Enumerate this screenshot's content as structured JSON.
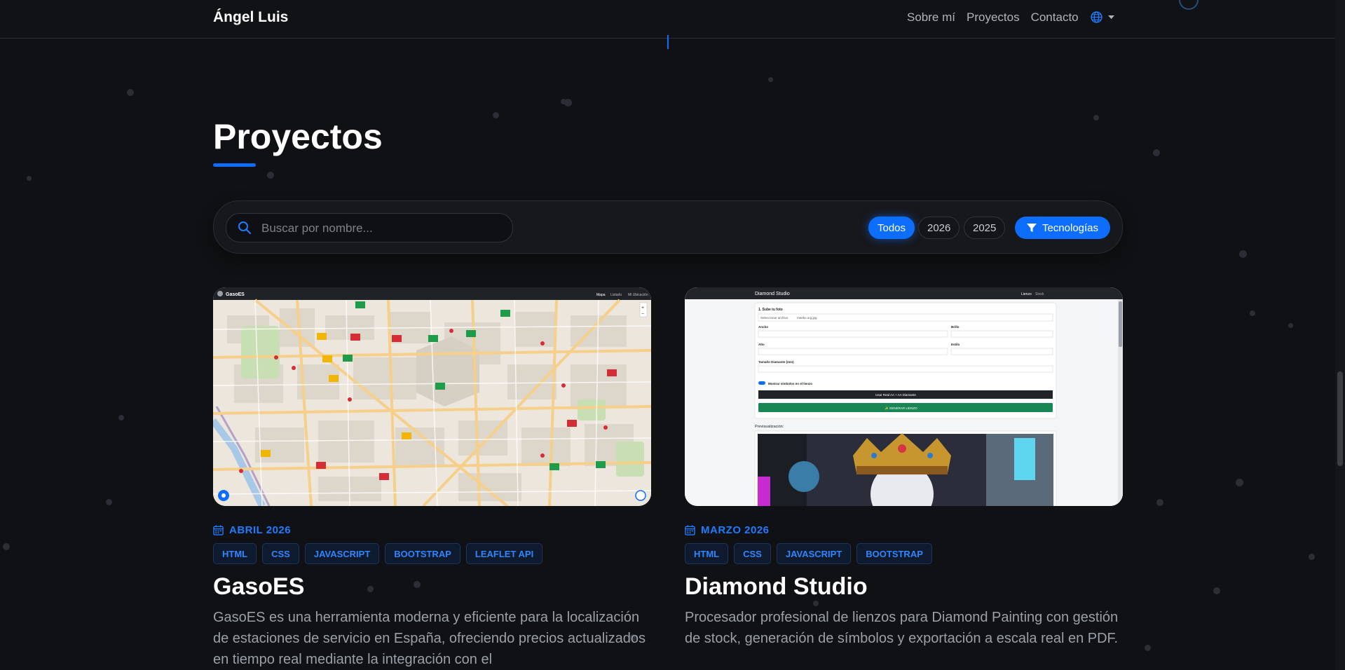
{
  "nav": {
    "brand": "Ángel Luis",
    "links": [
      "Sobre mí",
      "Proyectos",
      "Contacto"
    ],
    "language_icon": "globe-icon"
  },
  "section": {
    "title": "Proyectos"
  },
  "filters": {
    "search_placeholder": "Buscar por nombre...",
    "years": [
      "Todos",
      "2026",
      "2025"
    ],
    "active_year": "Todos",
    "tech_button": "Tecnologías"
  },
  "projects": [
    {
      "date": "ABRIL 2026",
      "tags": [
        "HTML",
        "CSS",
        "JAVASCRIPT",
        "BOOTSTRAP",
        "LEAFLET API"
      ],
      "title": "GasoES",
      "description": "GasoES es una herramienta moderna y eficiente para la localización de estaciones de servicio en España, ofreciendo precios actualizados en tiempo real mediante la integración con el",
      "preview": {
        "brand": "GasoES",
        "nav": [
          "Mapa",
          "Listado",
          "Mi Ubicación"
        ]
      }
    },
    {
      "date": "MARZO 2026",
      "tags": [
        "HTML",
        "CSS",
        "JAVASCRIPT",
        "BOOTSTRAP"
      ],
      "title": "Diamond Studio",
      "description": "Procesador profesional de lienzos para Diamond Painting con gestión de stock, generación de símbolos y exportación a escala real en PDF.",
      "preview": {
        "brand": "Diamond Studio",
        "nav": [
          "Lienzo",
          "Stock"
        ],
        "step": "1. Sube tu foto",
        "file_button": "Seleccionar archivo",
        "file_name": "meeko.org.jpg",
        "fields": [
          "Ancho",
          "Brillo",
          "Alto",
          "Estilo",
          "Tamaño Diamante (mm)"
        ],
        "toggle_label": "Mostrar símbolos en el lienzo",
        "dark_button": "Usar Real  AA + AA  Diamante",
        "generate_button": "✨ GENERAR LIENZO",
        "preview_label": "Previsualización:"
      }
    }
  ],
  "colors": {
    "accent": "#0d6efd",
    "background": "#101114",
    "tag_text": "#2f86ff"
  }
}
